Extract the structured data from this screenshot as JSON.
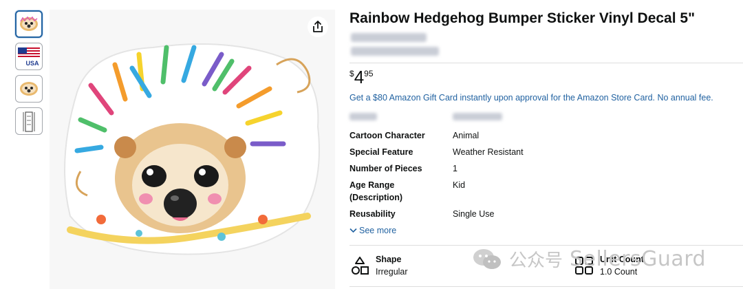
{
  "product": {
    "title": "Rainbow Hedgehog Bumper Sticker Vinyl Decal 5\"",
    "price_symbol": "$",
    "price_whole": "4",
    "price_fraction": "95",
    "promo_text": "Get a $80 Amazon Gift Card instantly upon approval for the Amazon Store Card. No annual fee."
  },
  "thumbnails": [
    {
      "icon": "hedgehog-thumb"
    },
    {
      "icon": "usa-flag-thumb",
      "text": "USA"
    },
    {
      "icon": "hedgehog-thumb"
    },
    {
      "icon": "sizing-thumb"
    }
  ],
  "specs": [
    {
      "key": "Cartoon Character",
      "value": "Animal"
    },
    {
      "key": "Special Feature",
      "value": "Weather Resistant"
    },
    {
      "key": "Number of Pieces",
      "value": "1"
    },
    {
      "key": "Age Range (Description)",
      "value": "Kid"
    },
    {
      "key": "Reusability",
      "value": "Single Use"
    }
  ],
  "see_more_label": "See more",
  "features": [
    {
      "title": "Shape",
      "value": "Irregular",
      "icon": "shapes-icon"
    },
    {
      "title": "Unit Count",
      "value": "1.0 Count",
      "icon": "grid-icon"
    }
  ],
  "watermark": {
    "cn": "公众号",
    "en": "SellersGuard"
  },
  "colors": {
    "link": "#2162a1",
    "text": "#0f1111",
    "divider": "#dddddd",
    "thumb_active": "#2162a1"
  }
}
